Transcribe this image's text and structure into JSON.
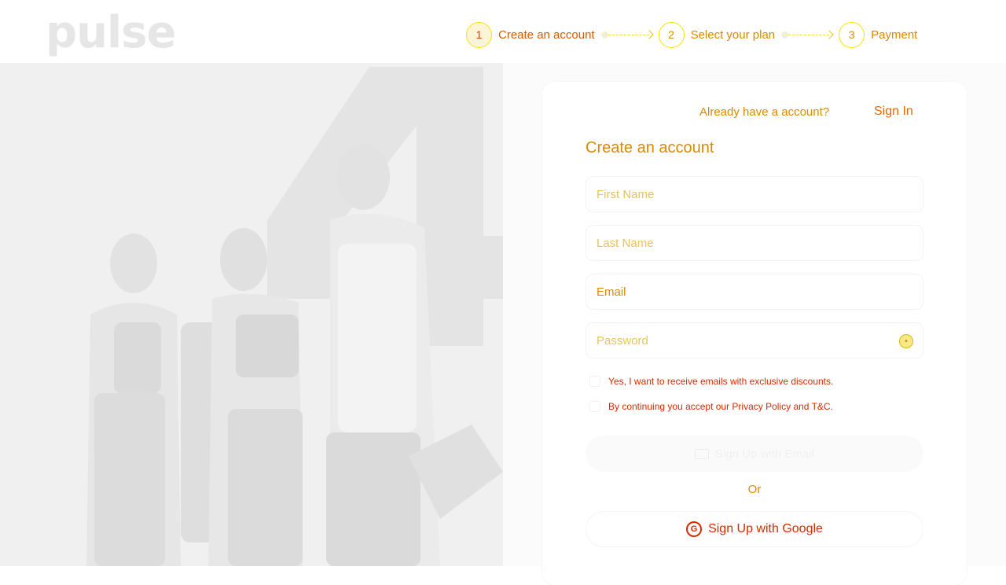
{
  "brand": {
    "logo_text": "pulse"
  },
  "stepper": {
    "steps": [
      {
        "number": "1",
        "label": "Create an account"
      },
      {
        "number": "2",
        "label": "Select your plan"
      },
      {
        "number": "3",
        "label": "Payment"
      }
    ]
  },
  "auth": {
    "already_text": "Already have a account?",
    "signin_label": "Sign In"
  },
  "form": {
    "title": "Create an account",
    "first_name_placeholder": "First Name",
    "last_name_placeholder": "Last Name",
    "email_placeholder": "Email",
    "password_placeholder": "Password",
    "marketing_checkbox_label": "Yes, I want to receive emails with exclusive discounts.",
    "terms_checkbox_label": "By continuing you accept our Privacy Policy and T&C.",
    "signup_email_label": "Sign Up with Email",
    "or_text": "Or",
    "signup_google_label": "Sign Up with Google"
  }
}
